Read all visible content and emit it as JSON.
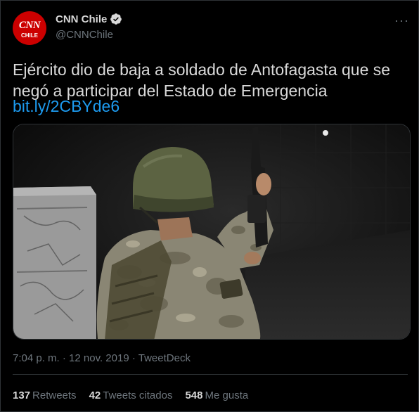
{
  "author": {
    "avatar_text_top": "CNN",
    "avatar_text_bottom": "CHILE",
    "display_name": "CNN Chile",
    "handle": "@CNNChile",
    "verified": true,
    "avatar_color": "#cc0000",
    "verified_color": "#d9d9d9"
  },
  "more_icon": "more-options-icon",
  "tweet": {
    "text": "Ejército dio de baja a soldado de Antofagasta que se negó a participar del Estado de Emergencia",
    "link": "bit.ly/2CBYde6",
    "link_color": "#1d9bf0"
  },
  "meta": {
    "time": "7:04 p. m.",
    "separator1": "·",
    "date": "12 nov. 2019",
    "separator2": "·",
    "source": "TweetDeck"
  },
  "stats": [
    {
      "count": "137",
      "label": "Retweets"
    },
    {
      "count": "42",
      "label": "Tweets citados"
    },
    {
      "count": "548",
      "label": "Me gusta"
    }
  ]
}
